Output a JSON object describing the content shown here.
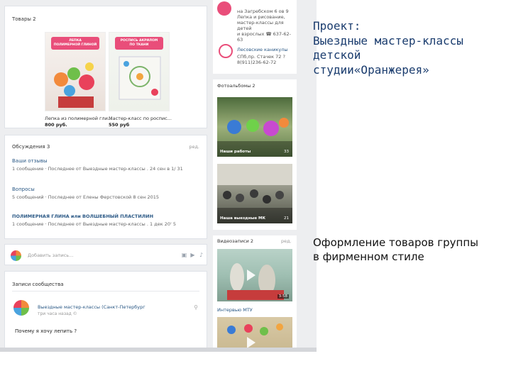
{
  "slide": {
    "project_lines": [
      "Проект:",
      "Выездные мастер-классы",
      "детской",
      "студии«Оранжерея»"
    ],
    "design_lines": [
      "Оформление товаров группы",
      "в фирменном стиле"
    ]
  },
  "goods": {
    "header": "Товары 2",
    "items": [
      {
        "title": "Лепка из полимерной гли...",
        "price": "800 руб."
      },
      {
        "title": "Мастер-класс по роспис...",
        "price": "550 руб"
      }
    ]
  },
  "discussions": {
    "header": "Обсуждения 3",
    "count": "ред.",
    "topics": [
      {
        "title": "Ваши отзывы",
        "detail": "1 сообщение · Последнее от Выездные мастер-классы . 24 сен в 1/ 31"
      },
      {
        "title": "Вопросы",
        "detail": "5 сообщений · Последнее от Елены Ферстовской 8 сен 2015"
      },
      {
        "title": "ПОЛИМЕРНАЯ ГЛИНА или ВОЛШЕБНЫЙ ПЛАСТИЛИН",
        "detail": "1 сообщение · Последнее от Выездные мастер-классы . 1 дек 20' 5"
      }
    ]
  },
  "postbox": {
    "placeholder": "Добавить запись..."
  },
  "community_posts": {
    "header": "Записи сообщества",
    "author": "Выездные мастер-классы (Санкт-Петербург",
    "time": "три часа назад ©",
    "text": "Почему я хочу лепить ?"
  },
  "right_column": {
    "contact_top": [
      "на Загребском 6 ов 9",
      "Лепка и рисование,",
      "мастер-классы для детей",
      "и взрослых ☎ 637-62-63"
    ],
    "contact2_name": "Лесовские каникулы",
    "contact2_lines": [
      "СПб,пр. Стачек 72 ?",
      "8(911)236-62-72"
    ],
    "photos_header": "Фотоальбомы 2",
    "album1": {
      "caption": "Наши работы",
      "count": "33"
    },
    "album2": {
      "caption": "Наша выездные МК",
      "count": "21"
    },
    "videos_header": "Видеозаписи 2",
    "videos_edit": "ред.",
    "video1": {
      "duration": "3:58"
    },
    "video2_title": "Интервью МТУ"
  },
  "colors": {
    "vk_link": "#2a5885",
    "slide_heading": "#1a3c6e",
    "background": "#edeef0"
  }
}
